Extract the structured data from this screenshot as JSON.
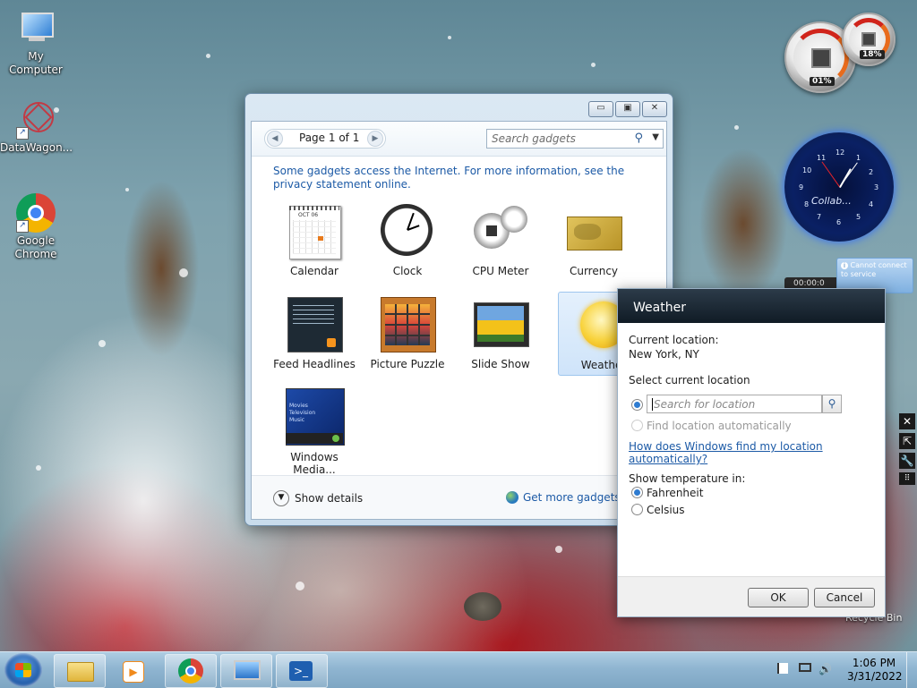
{
  "desktop": {
    "icons": [
      {
        "label": "My Computer"
      },
      {
        "label": "DataWagon..."
      },
      {
        "label": "Google Chrome"
      }
    ],
    "recycle_bin": "Recycle Bin"
  },
  "gallery": {
    "page_label": "Page 1 of 1",
    "search_placeholder": "Search gadgets",
    "info_text": "Some gadgets access the Internet.  For more information, see the privacy statement online.",
    "gadgets": [
      {
        "label": "Calendar",
        "icon": "calendar-icon"
      },
      {
        "label": "Clock",
        "icon": "clock-icon"
      },
      {
        "label": "CPU Meter",
        "icon": "cpu-meter-icon"
      },
      {
        "label": "Currency",
        "icon": "currency-icon"
      },
      {
        "label": "Feed Headlines",
        "icon": "feed-headlines-icon"
      },
      {
        "label": "Picture Puzzle",
        "icon": "picture-puzzle-icon"
      },
      {
        "label": "Slide Show",
        "icon": "slide-show-icon"
      },
      {
        "label": "Weather",
        "icon": "weather-icon"
      },
      {
        "label": "Windows Media...",
        "icon": "windows-media-icon"
      }
    ],
    "calendar_month": "OCT 06",
    "media_lines": [
      "Movies",
      "Television",
      "Music"
    ],
    "show_details": "Show details",
    "get_more": "Get more gadgets online"
  },
  "widgets": {
    "cpu_percent": "01%",
    "mem_percent": "18%",
    "clock_brand": "Collab...",
    "clock_numbers": [
      "12",
      "1",
      "2",
      "3",
      "4",
      "5",
      "6",
      "7",
      "8",
      "9",
      "10",
      "11"
    ],
    "notify_text": "Cannot connect to service",
    "timer_text": "00:00:0"
  },
  "weather_dialog": {
    "title": "Weather",
    "current_location_label": "Current location:",
    "current_location_value": "New York, NY",
    "select_label": "Select current location",
    "search_placeholder": "Search for location",
    "auto_label": "Find location automatically",
    "help_link": "How does Windows find my location automatically?",
    "temp_label": "Show temperature in:",
    "fahrenheit": "Fahrenheit",
    "celsius": "Celsius",
    "ok": "OK",
    "cancel": "Cancel"
  },
  "taskbar": {
    "time": "1:06 PM",
    "date": "3/31/2022"
  },
  "colors": {
    "link": "#1c5aa6",
    "accent": "#2f7cd1",
    "taskbar": "#8fb5d1"
  }
}
